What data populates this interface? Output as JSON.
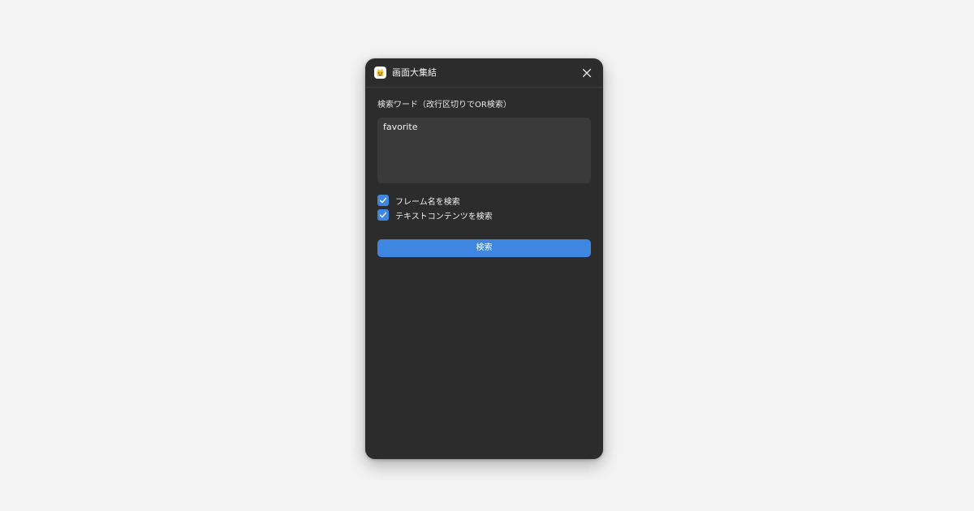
{
  "window": {
    "title": "画面大集結",
    "icon": "app-logo-icon",
    "close_icon": "close-icon"
  },
  "search": {
    "label": "検索ワード（改行区切りでOR検索）",
    "value": "favorite"
  },
  "options": [
    {
      "label": "フレーム名を検索",
      "checked": true
    },
    {
      "label": "テキストコンテンツを検索",
      "checked": true
    }
  ],
  "actions": {
    "search_button_label": "検索"
  },
  "colors": {
    "background": "#f4f4f4",
    "window": "#2c2c2c",
    "input": "#3a3a3a",
    "accent": "#3f86e0"
  }
}
